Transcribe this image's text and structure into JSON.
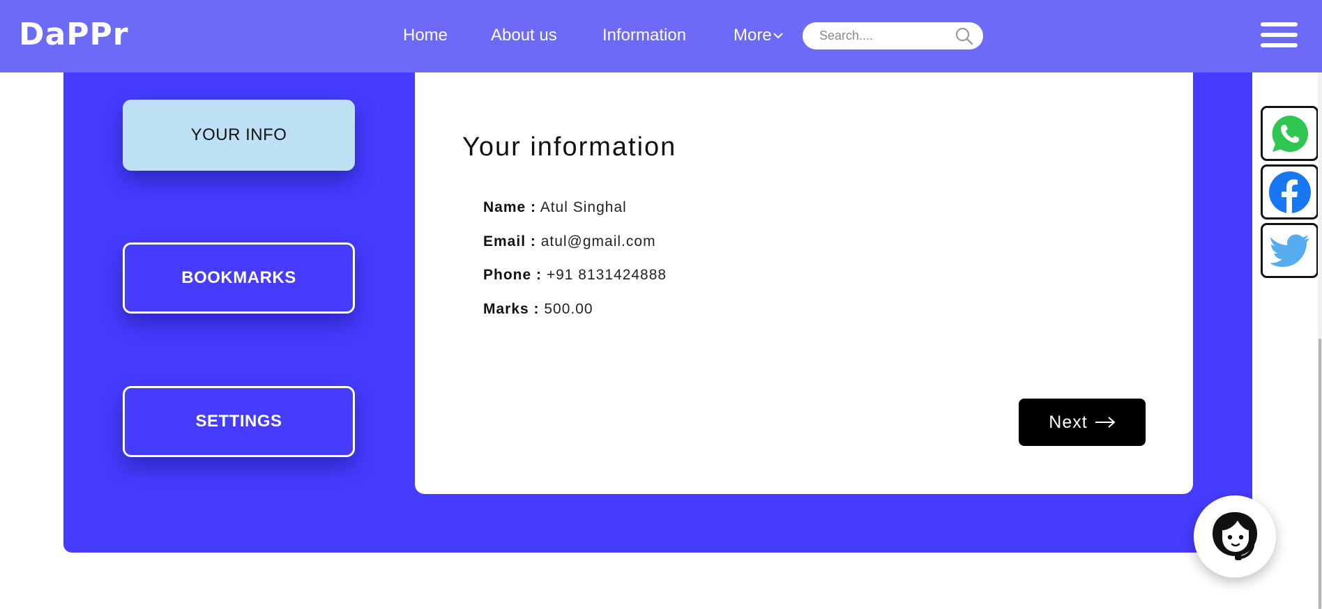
{
  "header": {
    "logo": "DaPPr",
    "nav": {
      "home": "Home",
      "about": "About us",
      "information": "Information",
      "more": "More"
    },
    "search": {
      "placeholder": "Search....",
      "value": ""
    }
  },
  "sidebar": {
    "items": [
      {
        "label": "YOUR INFO",
        "active": true
      },
      {
        "label": "BOOKMARKS",
        "active": false
      },
      {
        "label": "SETTINGS",
        "active": false
      }
    ]
  },
  "card": {
    "title": "Your information",
    "fields": [
      {
        "label": "Name :",
        "value": "Atul Singhal"
      },
      {
        "label": "Email :",
        "value": "atul@gmail.com"
      },
      {
        "label": "Phone :",
        "value": "+91 8131424888"
      },
      {
        "label": "Marks :",
        "value": "500.00"
      }
    ],
    "next_label": "Next"
  },
  "social": [
    "whatsapp-icon",
    "facebook-icon",
    "twitter-icon"
  ],
  "colors": {
    "navbar": "#6c6af7",
    "panel": "#453cff",
    "active_tab": "#bde0f5",
    "whatsapp": "#2fc652",
    "facebook": "#1877f2",
    "twitter": "#55acee"
  }
}
